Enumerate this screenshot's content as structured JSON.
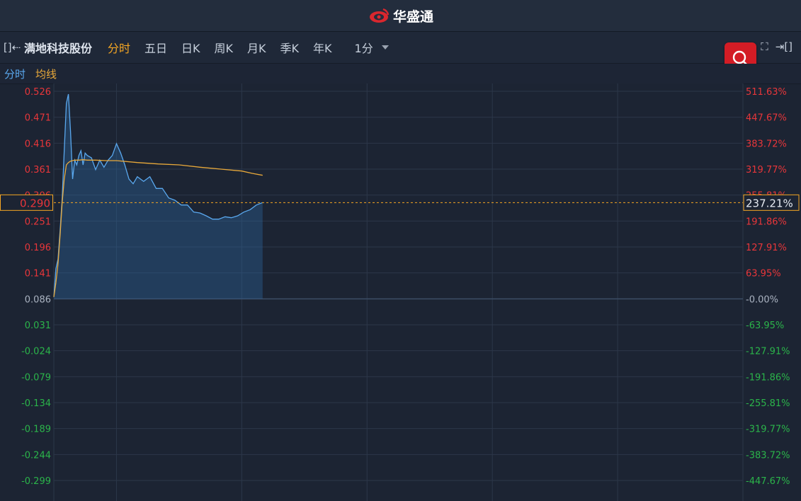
{
  "header": {
    "brand": "华盛通"
  },
  "toolbar": {
    "stock_name": "满地科技股份",
    "periods": [
      "分时",
      "五日",
      "日K",
      "周K",
      "月K",
      "季K",
      "年K"
    ],
    "active_period": "分时",
    "interval": "1分"
  },
  "legend": {
    "price": "分时",
    "avg": "均线"
  },
  "colors": {
    "up": "#e8363a",
    "down": "#2bb44a",
    "neutral": "#aab3c1",
    "price_line": "#5aa8ee",
    "avg_line": "#e9a93a",
    "grid": "#2c3749",
    "accent": "#f5a623"
  },
  "chart_data": {
    "type": "line",
    "prev_close": 0.086,
    "ylim": [
      -0.299,
      0.526
    ],
    "y_ticks": [
      "0.526",
      "0.471",
      "0.416",
      "0.361",
      "0.306",
      "0.251",
      "0.196",
      "0.141",
      "0.086",
      "0.031",
      "-0.024",
      "-0.079",
      "-0.134",
      "-0.189",
      "-0.244",
      "-0.299"
    ],
    "pct_ticks": [
      "511.63%",
      "447.67%",
      "383.72%",
      "319.77%",
      "255.81%",
      "191.86%",
      "127.91%",
      "63.95%",
      "-0.00%",
      "-63.95%",
      "-127.91%",
      "-191.86%",
      "-255.81%",
      "-319.77%",
      "-383.72%",
      "-447.67%"
    ],
    "current_price": "0.290",
    "current_pct": "237.21%",
    "total_minutes": 330,
    "series": [
      {
        "name": "分时",
        "x": [
          0,
          1,
          2,
          3,
          4,
          5,
          6,
          7,
          8,
          9,
          10,
          11,
          12,
          13,
          14,
          15,
          16,
          18,
          20,
          22,
          24,
          26,
          28,
          30,
          32,
          34,
          36,
          38,
          40,
          43,
          46,
          49,
          52,
          55,
          58,
          61,
          64,
          67,
          70,
          73,
          76,
          79,
          82,
          85,
          88,
          91,
          94,
          97,
          100
        ],
        "values": [
          0.09,
          0.15,
          0.17,
          0.23,
          0.3,
          0.4,
          0.5,
          0.52,
          0.44,
          0.34,
          0.38,
          0.37,
          0.39,
          0.4,
          0.37,
          0.395,
          0.39,
          0.385,
          0.36,
          0.38,
          0.365,
          0.38,
          0.39,
          0.415,
          0.395,
          0.37,
          0.34,
          0.33,
          0.345,
          0.335,
          0.345,
          0.32,
          0.32,
          0.3,
          0.295,
          0.285,
          0.285,
          0.27,
          0.268,
          0.262,
          0.255,
          0.255,
          0.26,
          0.258,
          0.262,
          0.27,
          0.275,
          0.285,
          0.29
        ]
      },
      {
        "name": "均线",
        "x": [
          0,
          1,
          2,
          3,
          4,
          5,
          6,
          7,
          8,
          10,
          12,
          14,
          16,
          20,
          25,
          30,
          40,
          50,
          60,
          70,
          80,
          90,
          95,
          100
        ],
        "values": [
          0.09,
          0.12,
          0.16,
          0.22,
          0.29,
          0.34,
          0.37,
          0.375,
          0.378,
          0.38,
          0.38,
          0.381,
          0.38,
          0.38,
          0.379,
          0.379,
          0.375,
          0.372,
          0.37,
          0.365,
          0.361,
          0.357,
          0.352,
          0.348
        ]
      }
    ]
  }
}
